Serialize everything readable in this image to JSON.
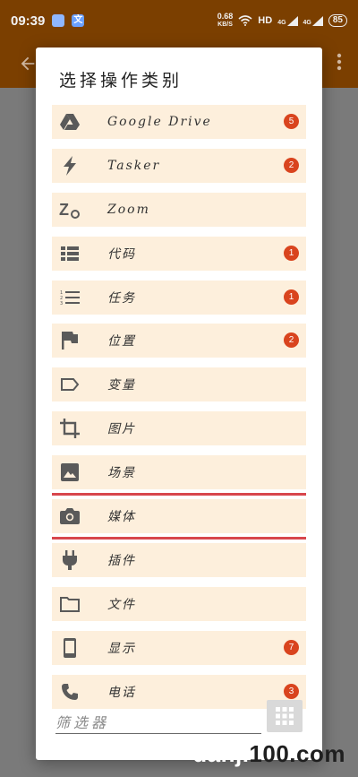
{
  "status_bar": {
    "time": "09:39",
    "lang_icon_text": "文",
    "net_speed_value": "0.68",
    "net_speed_unit": "KB/S",
    "hd_label": "HD",
    "signal1": "4G",
    "signal2": "4G",
    "battery": "85",
    "icons": [
      "qq-icon",
      "language-icon",
      "wifi-icon",
      "signal-icon",
      "battery-icon"
    ]
  },
  "app_bar": {
    "back_icon": "arrow-left-icon",
    "more_icon": "more-vert-icon"
  },
  "dialog": {
    "title": "选择操作类别",
    "items": [
      {
        "label": "Google Drive",
        "icon": "google-drive-icon",
        "badge": "5"
      },
      {
        "label": "Tasker",
        "icon": "tasker-bolt-icon",
        "badge": "2"
      },
      {
        "label": "Zoom",
        "icon": "zoom-icon",
        "badge": ""
      },
      {
        "label": "代码",
        "icon": "code-list-icon",
        "badge": "1"
      },
      {
        "label": "任务",
        "icon": "numbered-list-icon",
        "badge": "1"
      },
      {
        "label": "位置",
        "icon": "flag-icon",
        "badge": "2"
      },
      {
        "label": "变量",
        "icon": "label-tag-icon",
        "badge": ""
      },
      {
        "label": "图片",
        "icon": "crop-icon",
        "badge": ""
      },
      {
        "label": "场景",
        "icon": "image-icon",
        "badge": ""
      },
      {
        "label": "媒体",
        "icon": "camera-icon",
        "badge": ""
      },
      {
        "label": "插件",
        "icon": "plug-icon",
        "badge": ""
      },
      {
        "label": "文件",
        "icon": "folder-icon",
        "badge": ""
      },
      {
        "label": "显示",
        "icon": "phone-icon",
        "badge": "7"
      },
      {
        "label": "电话",
        "icon": "call-icon",
        "badge": "3"
      }
    ],
    "selected_index": 9,
    "filter": {
      "placeholder": "筛选器",
      "value": ""
    },
    "grid_button_icon": "grid-icon"
  },
  "watermark": {
    "prefix": "danji",
    "suffix": "100.com"
  },
  "colors": {
    "accent": "#7b3f00",
    "item_bg": "#fdefdc",
    "badge": "#d9441e",
    "highlight": "#d8464c"
  }
}
